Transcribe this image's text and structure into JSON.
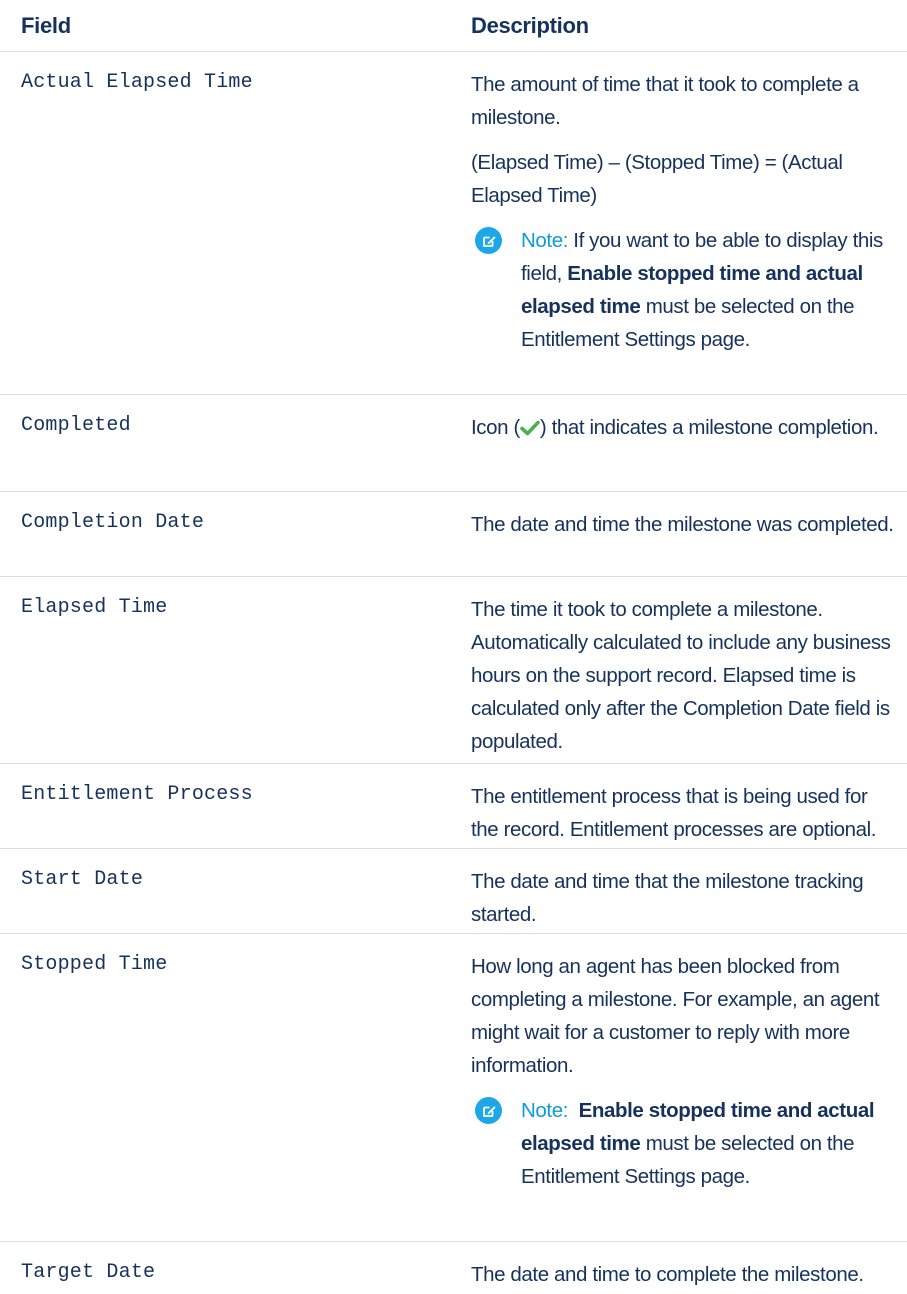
{
  "header": {
    "field": "Field",
    "description": "Description"
  },
  "colors": {
    "text": "#16325c",
    "note_label": "#0f9adb",
    "note_icon_bg": "#1ea7e8",
    "check": "#4bb14f",
    "divider": "#d8dde6"
  },
  "icons": {
    "note": "edit-note-icon",
    "completed": "green-checkmark-icon"
  },
  "rows": {
    "actual_elapsed": {
      "field": "Actual Elapsed Time",
      "desc": "The amount of time that it took to complete a milestone.",
      "formula": "(Elapsed Time) – (Stopped Time) = (Actual Elapsed Time)",
      "note_label": "Note:",
      "note_pre": " If you want to be able to display this field, ",
      "note_bold": "Enable stopped time and actual elapsed time",
      "note_post": " must be selected on the Entitlement Settings page."
    },
    "completed": {
      "field": "Completed",
      "desc_pre": "Icon (",
      "desc_post": ") that indicates a milestone completion."
    },
    "completion_date": {
      "field": "Completion Date",
      "desc": "The date and time the milestone was completed."
    },
    "elapsed_time": {
      "field": "Elapsed Time",
      "desc": "The time it took to complete a milestone. Automatically calculated to include any business hours on the support record. Elapsed time is calculated only after the Completion Date field is populated."
    },
    "entitlement_process": {
      "field": "Entitlement Process",
      "desc": "The entitlement process that is being used for the record. Entitlement processes are optional."
    },
    "start_date": {
      "field": "Start Date",
      "desc": "The date and time that the milestone tracking started."
    },
    "stopped_time": {
      "field": "Stopped Time",
      "desc": "How long an agent has been blocked from completing a milestone. For example, an agent might wait for a customer to reply with more information.",
      "note_label": "Note:",
      "note_bold": "Enable stopped time and actual elapsed time",
      "note_post": " must be selected on the Entitlement Settings page."
    },
    "target_date": {
      "field": "Target Date",
      "desc": "The date and time to complete the milestone."
    }
  }
}
